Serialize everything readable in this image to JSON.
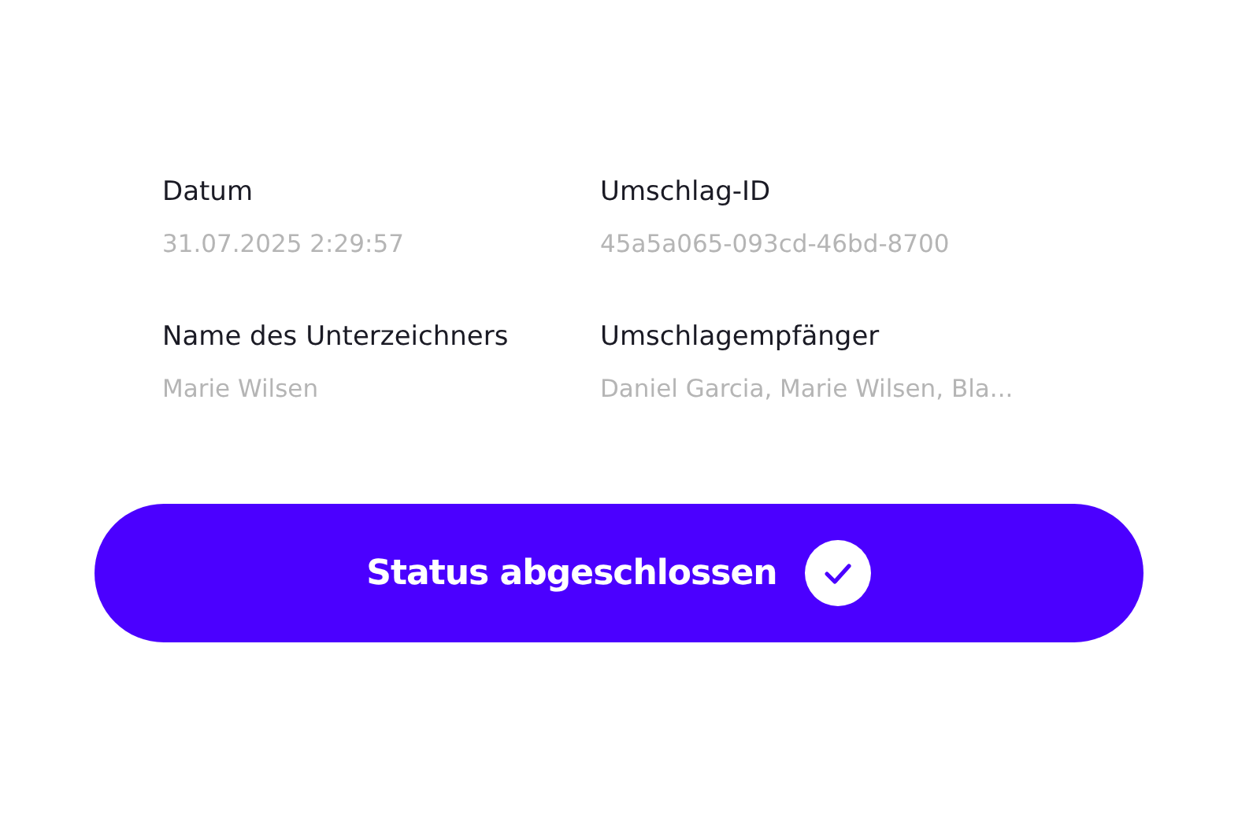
{
  "fields": [
    {
      "label": "Datum",
      "value": "31.07.2025 2:29:57"
    },
    {
      "label": "Umschlag-ID",
      "value": "45a5a065-093cd-46bd-8700"
    },
    {
      "label": "Name des Unterzeichners",
      "value": "Marie Wilsen"
    },
    {
      "label": "Umschlagempfänger",
      "value": "Daniel Garcia, Marie Wilsen, Bla..."
    }
  ],
  "status_button": {
    "label": "Status abgeschlossen",
    "completed": true
  }
}
